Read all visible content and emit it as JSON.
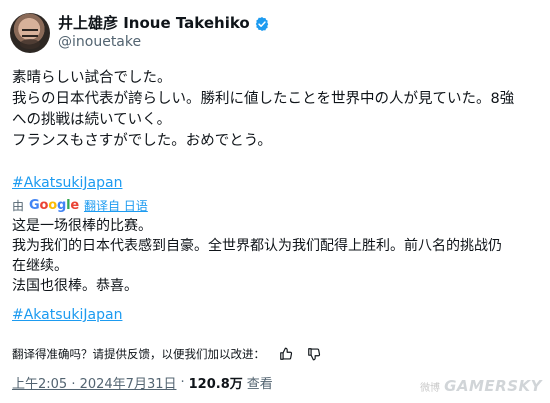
{
  "author": {
    "display_name": "井上雄彦 Inoue Takehiko",
    "handle": "@inouetake"
  },
  "original_text": [
    "素晴らしい試合でした。",
    "我らの日本代表が誇らしい。勝利に値したことを世界中の人が見ていた。8強",
    "への挑戦は続いていく。",
    "フランスもさすがでした。おめでとう。"
  ],
  "hashtag": "#AkatsukiJapan",
  "translation": {
    "by_label": "由",
    "provider": "Google",
    "link_label": "翻译自 日语",
    "lines": [
      "这是一场很棒的比赛。",
      "我为我们的日本代表感到自豪。全世界都认为我们配得上胜利。前八名的挑战仍",
      "在继续。",
      "法国也很棒。恭喜。"
    ],
    "hashtag": "#AkatsukiJapan"
  },
  "feedback": {
    "prompt": "翻译得准确吗？请提供反馈，以便我们加以改进："
  },
  "meta": {
    "time": "上午2:05 · 2024年7月31日",
    "separator": "·",
    "views_count": "120.8万",
    "views_label": "查看"
  },
  "watermark": {
    "weibo": "微博",
    "logo": "GAMERSKY"
  },
  "colors": {
    "link": "#1d9bf0",
    "secondary": "#536471",
    "verified": "#1d9bf0"
  }
}
